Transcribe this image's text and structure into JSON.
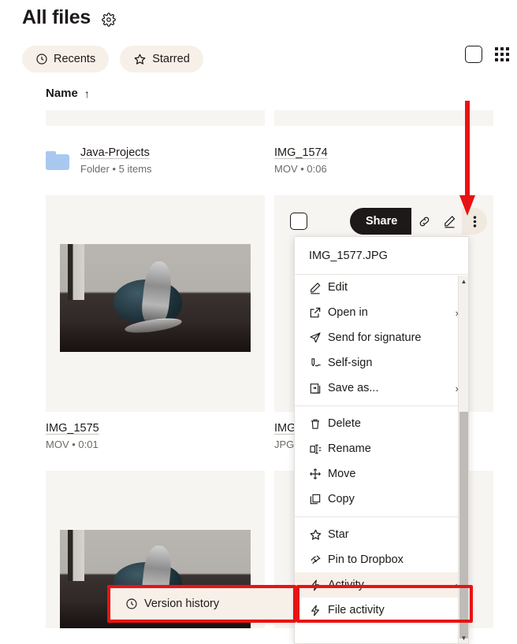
{
  "header": {
    "title": "All files",
    "settings_icon": "gear-icon"
  },
  "filters": [
    {
      "label": "Recents",
      "icon": "clock-icon"
    },
    {
      "label": "Starred",
      "icon": "star-icon"
    }
  ],
  "topright": {
    "select_all_checkbox": "",
    "view_toggle_icon": "grid-view-icon"
  },
  "column_header": {
    "label": "Name",
    "sort_arrow": "↑"
  },
  "files": [
    {
      "name": "Java-Projects",
      "sub": "Folder • 5 items",
      "kind": "folder"
    },
    {
      "name": "IMG_1574",
      "sub": "MOV • 0:06",
      "kind": "video"
    },
    {
      "name": "IMG_1575",
      "sub": "MOV • 0:01",
      "kind": "video"
    },
    {
      "name": "IMG",
      "sub": "JPG",
      "kind": "image"
    }
  ],
  "toolbar": {
    "share_label": "Share",
    "link_icon": "link-icon",
    "edit_icon": "pencil-icon",
    "more_icon": "three-dots-vertical-icon"
  },
  "context_menu": {
    "title": "IMG_1577.JPG",
    "groups": [
      [
        {
          "label": "Edit",
          "icon": "pencil-icon",
          "submenu": false,
          "highlighted": false
        },
        {
          "label": "Open in",
          "icon": "open-external-icon",
          "submenu": true,
          "highlighted": false
        },
        {
          "label": "Send for signature",
          "icon": "paper-plane-icon",
          "submenu": false,
          "highlighted": false
        },
        {
          "label": "Self-sign",
          "icon": "signature-pen-icon",
          "submenu": false,
          "highlighted": false
        },
        {
          "label": "Save as...",
          "icon": "save-as-icon",
          "submenu": true,
          "highlighted": false
        }
      ],
      [
        {
          "label": "Delete",
          "icon": "trash-icon",
          "submenu": false,
          "highlighted": false
        },
        {
          "label": "Rename",
          "icon": "rename-icon",
          "submenu": false,
          "highlighted": false
        },
        {
          "label": "Move",
          "icon": "move-arrows-icon",
          "submenu": false,
          "highlighted": false
        },
        {
          "label": "Copy",
          "icon": "copy-icon",
          "submenu": false,
          "highlighted": false
        }
      ],
      [
        {
          "label": "Star",
          "icon": "star-icon",
          "submenu": false,
          "highlighted": false
        },
        {
          "label": "Pin to Dropbox",
          "icon": "pin-icon",
          "submenu": false,
          "highlighted": false
        },
        {
          "label": "Activity",
          "icon": "lightning-icon",
          "submenu": true,
          "highlighted": true
        },
        {
          "label": "File activity",
          "icon": "lightning-icon",
          "submenu": false,
          "highlighted": false
        }
      ]
    ]
  },
  "version_history_flyout": {
    "label": "Version history",
    "icon": "clock-icon"
  },
  "annotations": {
    "arrow_color": "#e81313",
    "box_color": "#e81313",
    "arrow_target": "three-dots-vertical-icon",
    "boxes": [
      {
        "target": "version-history-flyout"
      },
      {
        "target": "menu-item-activity"
      }
    ]
  }
}
